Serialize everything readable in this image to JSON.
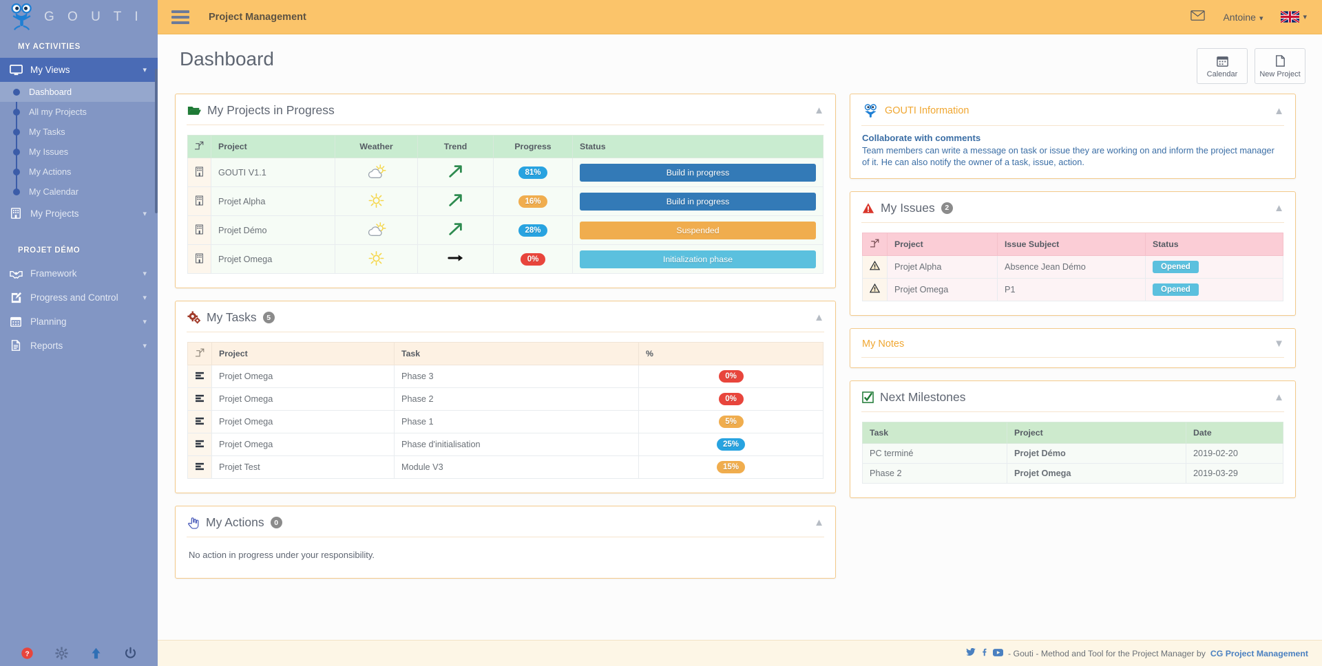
{
  "brand": {
    "name": "G O U T I",
    "logo_icon": "gouti-mascot-logo"
  },
  "sidebar": {
    "heading_activities": "MY ACTIVITIES",
    "heading_project": "PROJET DÉMO",
    "my_views": {
      "label": "My Views",
      "icon": "monitor-icon",
      "chevron": "chevron-down-icon"
    },
    "subitems": [
      {
        "label": "Dashboard"
      },
      {
        "label": "All my Projects"
      },
      {
        "label": "My Tasks"
      },
      {
        "label": "My Issues"
      },
      {
        "label": "My Actions"
      },
      {
        "label": "My Calendar"
      }
    ],
    "my_projects": {
      "label": "My Projects",
      "icon": "building-icon"
    },
    "project_items": [
      {
        "label": "Framework",
        "icon": "handshake-icon"
      },
      {
        "label": "Progress and Control",
        "icon": "edit-square-icon"
      },
      {
        "label": "Planning",
        "icon": "calendar-icon"
      },
      {
        "label": "Reports",
        "icon": "document-icon"
      }
    ],
    "footer_icons": [
      "help-circle-icon",
      "gear-icon",
      "upload-arrow-icon",
      "power-icon"
    ]
  },
  "topbar": {
    "menu_icon": "hamburger-menu-icon",
    "title": "Project Management",
    "mail_icon": "envelope-icon",
    "user": "Antoine",
    "language_flag": "uk-flag-icon",
    "accent": "#fbc46a"
  },
  "page": {
    "title": "Dashboard",
    "buttons": [
      {
        "label": "Calendar",
        "icon": "calendar-icon"
      },
      {
        "label": "New Project",
        "icon": "file-icon"
      }
    ]
  },
  "projects_card": {
    "title": "My Projects in Progress",
    "icon": "open-folder-icon",
    "columns": [
      "",
      "Project",
      "Weather",
      "Trend",
      "Progress",
      "Status"
    ],
    "rows": [
      {
        "project": "GOUTI V1.1",
        "weather": "partly-cloudy",
        "trend": "up",
        "progress": "81%",
        "progress_color": "blue",
        "status": "Build in progress",
        "status_color": "sb-blue"
      },
      {
        "project": "Projet Alpha",
        "weather": "sunny",
        "trend": "up",
        "progress": "16%",
        "progress_color": "orange",
        "status": "Build in progress",
        "status_color": "sb-blue"
      },
      {
        "project": "Projet Démo",
        "weather": "partly-cloudy",
        "trend": "up",
        "progress": "28%",
        "progress_color": "blue",
        "status": "Suspended",
        "status_color": "sb-orange"
      },
      {
        "project": "Projet Omega",
        "weather": "sunny",
        "trend": "flat",
        "progress": "0%",
        "progress_color": "red",
        "status": "Initialization phase",
        "status_color": "sb-cyan"
      }
    ]
  },
  "tasks_card": {
    "title": "My Tasks",
    "count": "5",
    "icon": "gears-icon",
    "columns": [
      "",
      "Project",
      "Task",
      "%"
    ],
    "rows": [
      {
        "project": "Projet Omega",
        "task": "Phase 3",
        "pct": "0%",
        "pct_color": "red"
      },
      {
        "project": "Projet Omega",
        "task": "Phase 2",
        "pct": "0%",
        "pct_color": "red"
      },
      {
        "project": "Projet Omega",
        "task": "Phase 1",
        "pct": "5%",
        "pct_color": "orange"
      },
      {
        "project": "Projet Omega",
        "task": "Phase d'initialisation",
        "pct": "25%",
        "pct_color": "blue"
      },
      {
        "project": "Projet Test",
        "task": "Module V3",
        "pct": "15%",
        "pct_color": "orange"
      }
    ]
  },
  "actions_card": {
    "title": "My Actions",
    "count": "0",
    "icon": "hand-pointer-icon",
    "empty_message": "No action in progress under your responsibility."
  },
  "info_card": {
    "title": "GOUTI Information",
    "icon": "gouti-mascot-icon",
    "subtitle": "Collaborate with comments",
    "text": "Team members can write a message on task or issue they are working on and inform the project manager of it. He can also notify the owner of a task, issue, action."
  },
  "issues_card": {
    "title": "My Issues",
    "count": "2",
    "icon": "warning-triangle-icon",
    "columns": [
      "",
      "Project",
      "Issue Subject",
      "Status"
    ],
    "rows": [
      {
        "project": "Projet Alpha",
        "subject": "Absence Jean Démo",
        "status": "Opened"
      },
      {
        "project": "Projet Omega",
        "subject": "P1",
        "status": "Opened"
      }
    ]
  },
  "notes_card": {
    "title": "My Notes"
  },
  "milestones_card": {
    "title": "Next Milestones",
    "icon": "check-square-icon",
    "columns": [
      "Task",
      "Project",
      "Date"
    ],
    "rows": [
      {
        "task": "PC terminé",
        "project": "Projet Démo",
        "date": "2019-02-20"
      },
      {
        "task": "Phase 2",
        "project": "Projet Omega",
        "date": "2019-03-29"
      }
    ]
  },
  "footer": {
    "social": [
      "twitter-icon",
      "facebook-icon",
      "youtube-icon"
    ],
    "text": "- Gouti - Method and Tool for the Project Manager by",
    "link": "CG Project Management"
  }
}
